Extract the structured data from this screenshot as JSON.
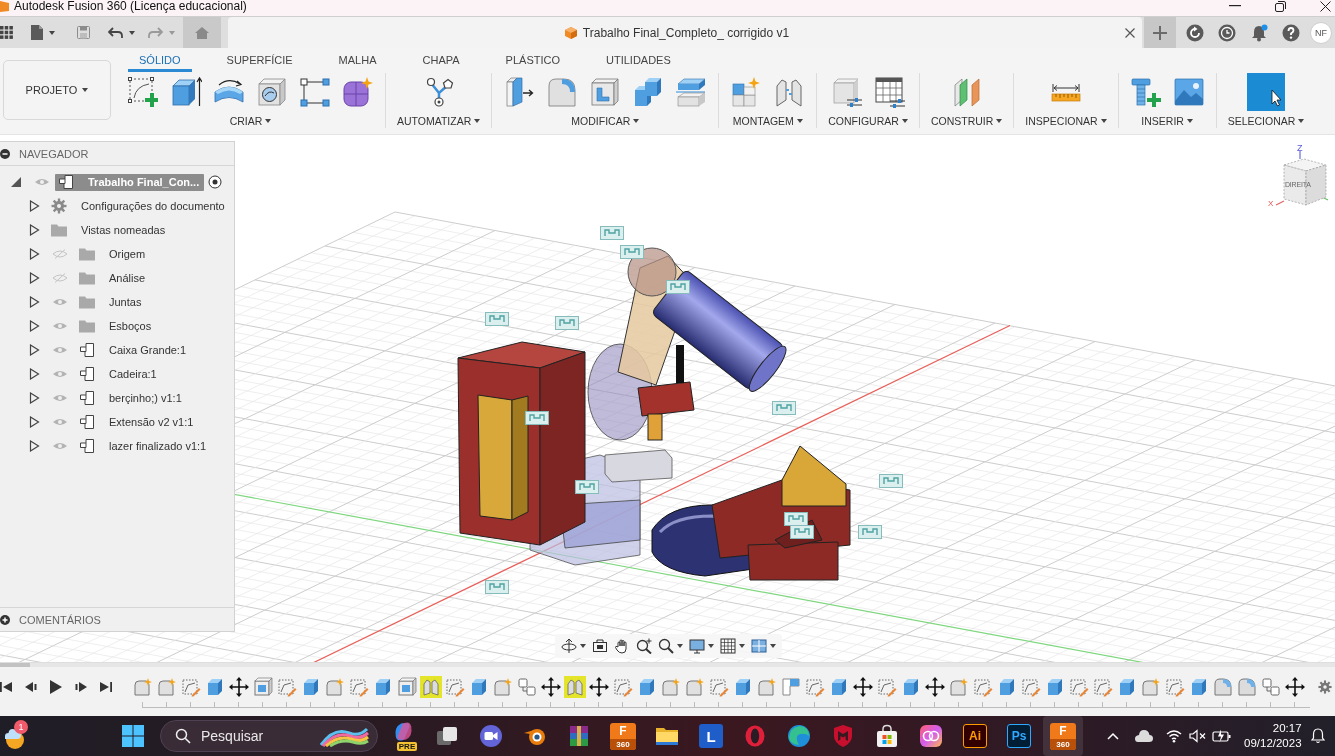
{
  "title_bar": {
    "title": "Autodesk Fusion 360 (Licença educacional)"
  },
  "document_tab": {
    "title": "Trabalho Final_Completo_ corrigido v1"
  },
  "account": {
    "initials": "NF",
    "notification": true
  },
  "toolbar": {
    "project_button": "PROJETO",
    "tabs": [
      {
        "label": "SÓLIDO",
        "selected": true
      },
      {
        "label": "SUPERFÍCIE",
        "selected": false
      },
      {
        "label": "MALHA",
        "selected": false
      },
      {
        "label": "CHAPA",
        "selected": false
      },
      {
        "label": "PLÁSTICO",
        "selected": false
      },
      {
        "label": "UTILIDADES",
        "selected": false
      }
    ],
    "groups": [
      {
        "label": "CRIAR",
        "tools": [
          {
            "kind": "sketch"
          },
          {
            "kind": "extrude"
          },
          {
            "kind": "revolve"
          },
          {
            "kind": "hole"
          },
          {
            "kind": "pattern"
          },
          {
            "kind": "form"
          }
        ]
      },
      {
        "label": "AUTOMATIZAR",
        "tools": [
          {
            "kind": "automate"
          }
        ]
      },
      {
        "label": "MODIFICAR",
        "tools": [
          {
            "kind": "press-pull"
          },
          {
            "kind": "fillet"
          },
          {
            "kind": "shell"
          },
          {
            "kind": "combine"
          },
          {
            "kind": "split"
          }
        ]
      },
      {
        "label": "MONTAGEM",
        "tools": [
          {
            "kind": "new-component"
          },
          {
            "kind": "joint"
          }
        ]
      },
      {
        "label": "CONFIGURAR",
        "tools": [
          {
            "kind": "configure"
          },
          {
            "kind": "table"
          }
        ]
      },
      {
        "label": "CONSTRUIR",
        "tools": [
          {
            "kind": "plane"
          }
        ]
      },
      {
        "label": "INSPECIONAR",
        "tools": [
          {
            "kind": "measure"
          }
        ]
      },
      {
        "label": "INSERIR",
        "tools": [
          {
            "kind": "bolt"
          },
          {
            "kind": "image"
          }
        ]
      },
      {
        "label": "SELECIONAR",
        "tools": [
          {
            "kind": "select"
          }
        ]
      }
    ]
  },
  "navigator": {
    "title": "NAVEGADOR",
    "tree": [
      {
        "label": "Trabalho Final_Con...",
        "kind": "component",
        "visible": true,
        "expanded": true,
        "selected": true,
        "active": true,
        "children": [
          {
            "label": "Configurações do documento",
            "kind": "settings",
            "expanded": false,
            "selected": false,
            "active": false
          },
          {
            "label": "Vistas nomeadas",
            "kind": "folder",
            "expanded": false,
            "selected": false,
            "active": false
          },
          {
            "label": "Origem",
            "kind": "folder",
            "visible": false,
            "expanded": false,
            "selected": false,
            "active": false
          },
          {
            "label": "Análise",
            "kind": "folder",
            "visible": false,
            "expanded": false,
            "selected": false,
            "active": false
          },
          {
            "label": "Juntas",
            "kind": "folder",
            "visible": true,
            "expanded": false,
            "selected": false,
            "active": false
          },
          {
            "label": "Esboços",
            "kind": "folder",
            "visible": true,
            "expanded": false,
            "selected": false,
            "active": false
          },
          {
            "label": "Caixa Grande:1",
            "kind": "component",
            "visible": true,
            "expanded": false,
            "selected": false,
            "active": false
          },
          {
            "label": "Cadeira:1",
            "kind": "component",
            "visible": true,
            "expanded": false,
            "selected": false,
            "active": false
          },
          {
            "label": "berçinho;) v1:1",
            "kind": "component",
            "visible": true,
            "expanded": false,
            "selected": false,
            "active": false
          },
          {
            "label": "Extensão v2 v1:1",
            "kind": "component",
            "visible": true,
            "expanded": false,
            "selected": false,
            "active": false
          },
          {
            "label": "lazer finalizado v1:1",
            "kind": "component",
            "visible": true,
            "expanded": false,
            "selected": false,
            "active": false
          }
        ]
      }
    ],
    "comments_title": "COMENTÁRIOS"
  },
  "view_cube": {
    "face": "DIREITA",
    "z_label": "Z",
    "x_label": "X"
  },
  "timeline": {
    "features": [
      {
        "kind": "component",
        "highlighted": false
      },
      {
        "kind": "component",
        "highlighted": false
      },
      {
        "kind": "sketch",
        "highlighted": false
      },
      {
        "kind": "extrude",
        "highlighted": false
      },
      {
        "kind": "move",
        "highlighted": false
      },
      {
        "kind": "shell",
        "highlighted": false
      },
      {
        "kind": "sketch",
        "highlighted": false
      },
      {
        "kind": "extrude",
        "highlighted": false
      },
      {
        "kind": "component",
        "highlighted": false
      },
      {
        "kind": "sketch",
        "highlighted": false
      },
      {
        "kind": "extrude",
        "highlighted": false
      },
      {
        "kind": "shell",
        "highlighted": false
      },
      {
        "kind": "joint",
        "highlighted": true
      },
      {
        "kind": "sketch",
        "highlighted": false
      },
      {
        "kind": "extrude",
        "highlighted": false
      },
      {
        "kind": "component",
        "highlighted": false
      },
      {
        "kind": "rigid-group",
        "highlighted": false
      },
      {
        "kind": "move",
        "highlighted": false
      },
      {
        "kind": "joint",
        "highlighted": true
      },
      {
        "kind": "move",
        "highlighted": false
      },
      {
        "kind": "sketch",
        "highlighted": false
      },
      {
        "kind": "extrude",
        "highlighted": false
      },
      {
        "kind": "component",
        "highlighted": false
      },
      {
        "kind": "component",
        "highlighted": false
      },
      {
        "kind": "sketch",
        "highlighted": false
      },
      {
        "kind": "extrude",
        "highlighted": false
      },
      {
        "kind": "component",
        "highlighted": false
      },
      {
        "kind": "corner",
        "highlighted": false
      },
      {
        "kind": "sketch",
        "highlighted": false
      },
      {
        "kind": "extrude",
        "highlighted": false
      },
      {
        "kind": "move",
        "highlighted": false
      },
      {
        "kind": "sketch",
        "highlighted": false
      },
      {
        "kind": "extrude",
        "highlighted": false
      },
      {
        "kind": "move",
        "highlighted": false
      },
      {
        "kind": "component",
        "highlighted": false
      },
      {
        "kind": "sketch",
        "highlighted": false
      },
      {
        "kind": "extrude",
        "highlighted": false
      },
      {
        "kind": "sketch",
        "highlighted": false
      },
      {
        "kind": "extrude",
        "highlighted": false
      },
      {
        "kind": "sketch",
        "highlighted": false
      },
      {
        "kind": "sketch",
        "highlighted": false
      },
      {
        "kind": "extrude",
        "highlighted": false
      },
      {
        "kind": "component",
        "highlighted": false
      },
      {
        "kind": "sketch",
        "highlighted": false
      },
      {
        "kind": "extrude",
        "highlighted": false
      },
      {
        "kind": "fillet",
        "highlighted": false
      },
      {
        "kind": "fillet",
        "highlighted": false
      },
      {
        "kind": "rigid-group",
        "highlighted": false
      },
      {
        "kind": "move",
        "highlighted": false
      }
    ]
  },
  "taskbar": {
    "weather_badge": "1",
    "search": {
      "placeholder": "Pesquisar"
    },
    "apps": [
      {
        "kind": "copilot",
        "label": "PRE",
        "selected": false
      },
      {
        "kind": "task-view",
        "selected": false
      },
      {
        "kind": "meet",
        "selected": false
      },
      {
        "kind": "blender",
        "selected": false
      },
      {
        "kind": "winrar",
        "selected": false
      },
      {
        "kind": "fusion",
        "label": "F",
        "sublabel": "360",
        "selected": false
      },
      {
        "kind": "explorer",
        "selected": false
      },
      {
        "kind": "letter",
        "label": "L",
        "selected": false
      },
      {
        "kind": "opera",
        "selected": false
      },
      {
        "kind": "edge",
        "selected": false
      },
      {
        "kind": "mcafee",
        "selected": false
      },
      {
        "kind": "store",
        "selected": false
      },
      {
        "kind": "creative-cloud",
        "selected": false
      },
      {
        "kind": "illustrator",
        "label": "Ai",
        "selected": false
      },
      {
        "kind": "photoshop",
        "label": "Ps",
        "selected": false
      },
      {
        "kind": "fusion",
        "label": "F",
        "sublabel": "360",
        "selected": true
      }
    ],
    "clock": {
      "time": "20:17",
      "date": "09/12/2023"
    }
  }
}
